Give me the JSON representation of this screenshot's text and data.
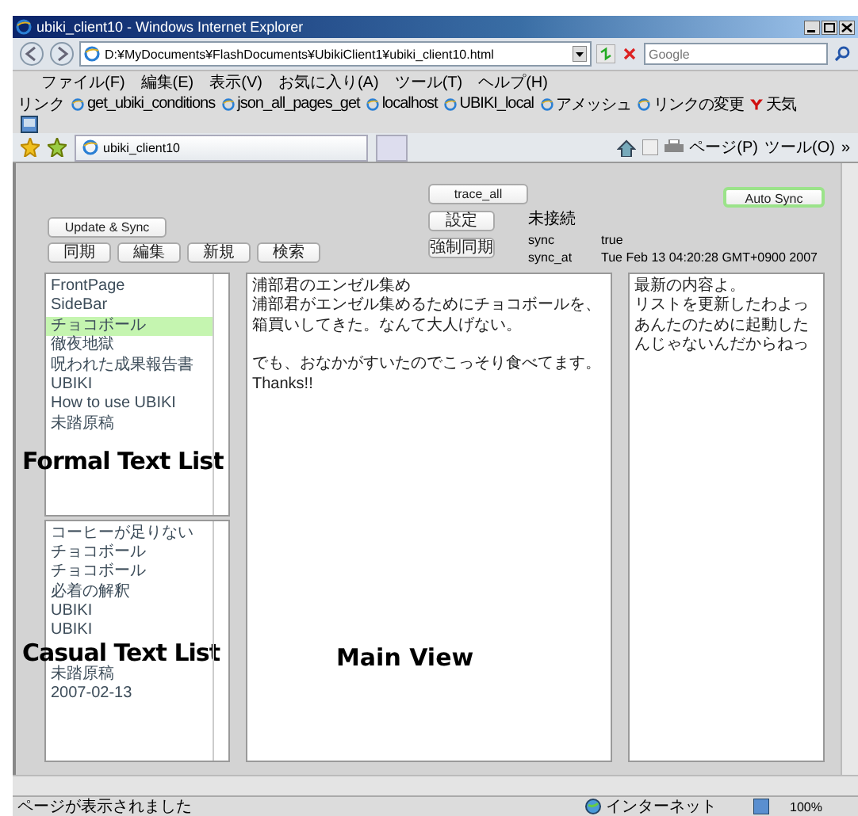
{
  "window": {
    "title": "ubiki_client10 - Windows Internet Explorer"
  },
  "address_bar": {
    "url": "D:¥MyDocuments¥FlashDocuments¥UbikiClient1¥ubiki_client10.html"
  },
  "search": {
    "placeholder": "Google"
  },
  "menu": [
    "ファイル(F)",
    "編集(E)",
    "表示(V)",
    "お気に入り(A)",
    "ツール(T)",
    "ヘルプ(H)"
  ],
  "links_label": "リンク",
  "links": [
    {
      "label": "get_ubiki_conditions",
      "kind": "ie"
    },
    {
      "label": "json_all_pages_get",
      "kind": "ie"
    },
    {
      "label": "localhost",
      "kind": "ie"
    },
    {
      "label": "UBIKI_local",
      "kind": "ie"
    },
    {
      "label": "アメッシュ",
      "kind": "ie"
    },
    {
      "label": "リンクの変更",
      "kind": "ie"
    },
    {
      "label": "天気",
      "kind": "yahoo"
    }
  ],
  "tab": {
    "title": "ubiki_client10"
  },
  "command_bar": [
    "ページ(P)",
    "ツール(O)",
    "»"
  ],
  "app": {
    "trace_button": "trace_all",
    "auto_sync": {
      "label": "Auto Sync",
      "active": true
    },
    "update_button": "Update & Sync",
    "actions": [
      "同期",
      "編集",
      "新規",
      "検索"
    ],
    "settings_button": "設定",
    "force_sync_button": "強制同期",
    "connection": "未接続",
    "fields": [
      {
        "key": "sync",
        "value": "true"
      },
      {
        "key": "sync_at",
        "value": "Tue Feb 13 04:20:28 GMT+0900 2007"
      }
    ],
    "formal_list": {
      "items": [
        {
          "label": "FrontPage",
          "selected": false
        },
        {
          "label": "SideBar",
          "selected": false
        },
        {
          "label": "チョコボール",
          "selected": true
        },
        {
          "label": "徹夜地獄",
          "selected": false
        },
        {
          "label": "呪われた成果報告書",
          "selected": false
        },
        {
          "label": "UBIKI",
          "selected": false
        },
        {
          "label": "How to use UBIKI",
          "selected": false
        },
        {
          "label": "未踏原稿",
          "selected": false
        }
      ],
      "caption": "Formal Text List"
    },
    "casual_list": {
      "items": [
        {
          "label": "コーヒーが足りない",
          "selected": false
        },
        {
          "label": "チョコボール",
          "selected": false
        },
        {
          "label": "チョコボール",
          "selected": false
        },
        {
          "label": "必着の解釈",
          "selected": false
        },
        {
          "label": "UBIKI",
          "selected": false
        },
        {
          "label": "UBIKI",
          "selected": false
        }
      ],
      "caption": "Casual Text List",
      "items_after_caption": [
        {
          "label": "未踏原稿",
          "selected": false
        },
        {
          "label": "2007-02-13",
          "selected": false
        }
      ]
    },
    "main_view": {
      "caption": "Main View",
      "paragraphs": [
        [
          "浦部君のエンゼル集め",
          "浦部君がエンゼル集めるためにチョコボールを、箱買いしてきた。なんて大人げない。"
        ],
        [
          "でも、おなかがすいたのでこっそり食べてます。Thanks!!"
        ]
      ]
    },
    "side_view": {
      "lines": [
        "最新の内容よ。",
        "リストを更新したわよっ",
        "あんたのために起動したんじゃないんだからねっ"
      ]
    }
  },
  "status_bar": {
    "message": "ページが表示されました",
    "zone": "インターネット",
    "zoom": "100%"
  }
}
